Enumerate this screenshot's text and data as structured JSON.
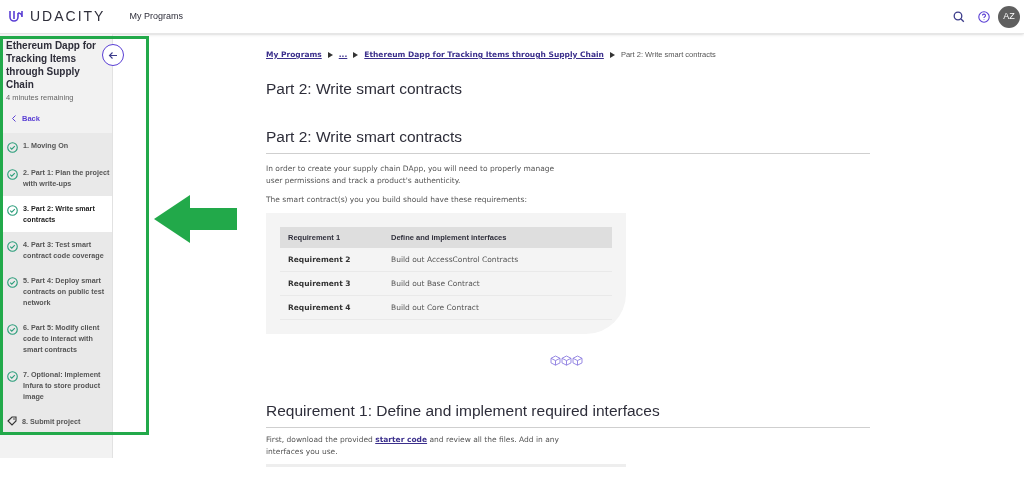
{
  "header": {
    "logo": "UDACITY",
    "nav_link": "My Programs",
    "avatar": "AZ"
  },
  "sidebar": {
    "title": "Ethereum Dapp for Tracking Items through Supply Chain",
    "remaining": "4 minutes remaining",
    "back": "Back",
    "items": [
      {
        "label": "1. Moving On",
        "kind": "lesson",
        "completed": true,
        "selected": false
      },
      {
        "label": "2. Part 1: Plan the project with write-ups",
        "kind": "lesson",
        "completed": true,
        "selected": false
      },
      {
        "label": "3. Part 2: Write smart contracts",
        "kind": "lesson",
        "completed": true,
        "selected": true
      },
      {
        "label": "4. Part 3: Test smart contract code coverage",
        "kind": "lesson",
        "completed": true,
        "selected": false
      },
      {
        "label": "5. Part 4: Deploy smart contracts on public test network",
        "kind": "lesson",
        "completed": true,
        "selected": false
      },
      {
        "label": "6. Part 5: Modify client code to interact with smart contracts",
        "kind": "lesson",
        "completed": true,
        "selected": false
      },
      {
        "label": "7. Optional: Implement Infura to store product image",
        "kind": "lesson",
        "completed": true,
        "selected": false
      },
      {
        "label": "8. Submit project",
        "kind": "project",
        "selected": false
      }
    ]
  },
  "breadcrumb": [
    {
      "label": "My Programs",
      "kind": "link"
    },
    {
      "label": "...",
      "kind": "link"
    },
    {
      "label": "Ethereum Dapp for Tracking Items through Supply Chain",
      "kind": "link"
    },
    {
      "label": "Part 2: Write smart contracts",
      "kind": "current"
    }
  ],
  "page_title": "Part 2: Write smart contracts",
  "section_title": "Part 2: Write smart contracts",
  "paragraphs": [
    "In order to create your supply chain DApp, you will need to properly manage user permissions and track a product's authenticity.",
    "The smart contract(s) you you build should have these requirements:"
  ],
  "table": {
    "header": [
      "Requirement 1",
      "Define and implement interfaces"
    ],
    "rows": [
      [
        "Requirement 2",
        "Build out AccessControl Contracts"
      ],
      [
        "Requirement 3",
        "Build out Base Contract"
      ],
      [
        "Requirement 4",
        "Build out Core Contract"
      ]
    ]
  },
  "requirement_title": "Requirement 1: Define and implement required interfaces",
  "requirement_text": {
    "before": "First, download the provided ",
    "link": "starter code",
    "after": " and review all the files. Add in any interfaces you use."
  }
}
